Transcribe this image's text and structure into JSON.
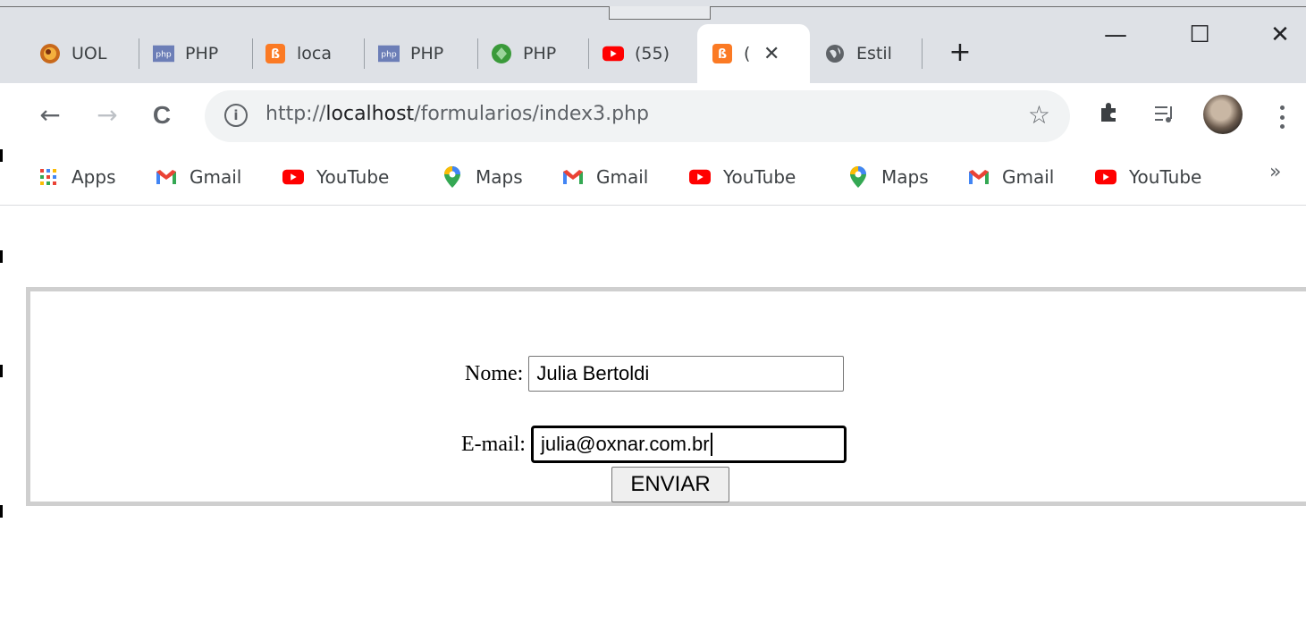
{
  "tabs": [
    {
      "title": "UOL",
      "icon": "uol-icon"
    },
    {
      "title": "PHP",
      "icon": "php-icon"
    },
    {
      "title": "local",
      "icon": "xampp-icon"
    },
    {
      "title": "PHP",
      "icon": "php-icon"
    },
    {
      "title": "PHP",
      "icon": "recycle-icon"
    },
    {
      "title": "(55)",
      "icon": "youtube-icon"
    },
    {
      "title": "(",
      "icon": "xampp-icon",
      "active": true
    },
    {
      "title": "Estil",
      "icon": "globe-icon"
    }
  ],
  "window_controls": {
    "minimize": "—",
    "maximize": "☐",
    "close": "✕"
  },
  "toolbar": {
    "back": "←",
    "forward": "→",
    "reload": "C",
    "url_scheme": "http://",
    "url_host": "localhost",
    "url_path": "/formularios/index3.php"
  },
  "bookmarks": [
    {
      "label": "Apps",
      "icon": "apps-grid-icon"
    },
    {
      "label": "Gmail",
      "icon": "gmail-icon"
    },
    {
      "label": "YouTube",
      "icon": "youtube-icon"
    },
    {
      "label": "Maps",
      "icon": "maps-icon"
    },
    {
      "label": "Gmail",
      "icon": "gmail-icon"
    },
    {
      "label": "YouTube",
      "icon": "youtube-icon"
    },
    {
      "label": "Maps",
      "icon": "maps-icon"
    },
    {
      "label": "Gmail",
      "icon": "gmail-icon"
    },
    {
      "label": "YouTube",
      "icon": "youtube-icon"
    }
  ],
  "bookmarks_overflow": "»",
  "form": {
    "nome_label": "Nome:",
    "nome_value": "Julia Bertoldi",
    "email_label": "E-mail:",
    "email_value": "julia@oxnar.com.br",
    "submit_label": "ENVIAR"
  },
  "colors": {
    "tabstrip_bg": "#dee1e6",
    "omnibox_bg": "#f1f3f4",
    "fieldset_border": "#cfcfcf",
    "youtube_red": "#ff0000",
    "xampp_orange": "#fb7a24",
    "php_purple": "#6c7eb7"
  }
}
